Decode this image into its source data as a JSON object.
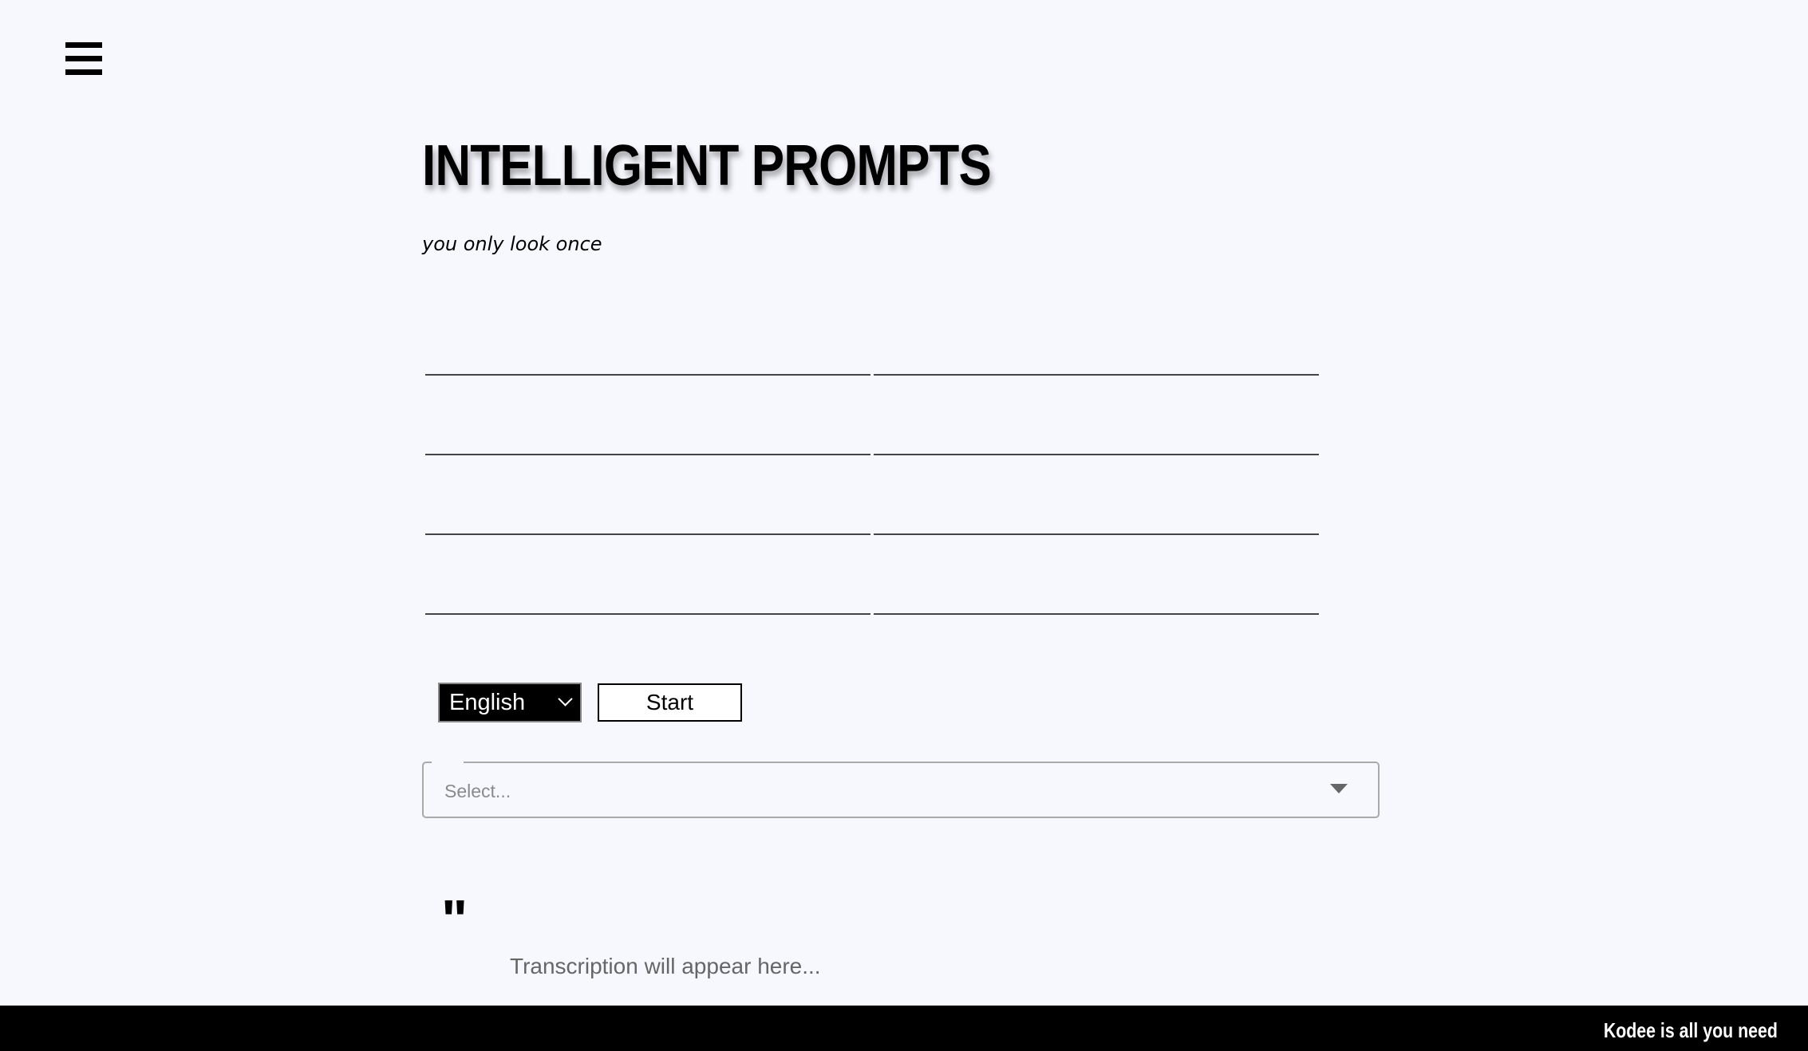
{
  "header": {
    "title": "INTELLIGENT PROMPTS",
    "subtitle": "you only look once"
  },
  "controls": {
    "language_selected": "English",
    "start_label": "Start"
  },
  "combo": {
    "placeholder": "Select..."
  },
  "transcription": {
    "quote_mark": "\"",
    "placeholder": "Transcription will appear here..."
  },
  "footer": {
    "text": "Kodee is all you need"
  },
  "icons": {
    "menu": "hamburger-menu-icon",
    "language_dropdown": "chevron-down-icon",
    "combo_dropdown": "caret-down-icon"
  }
}
